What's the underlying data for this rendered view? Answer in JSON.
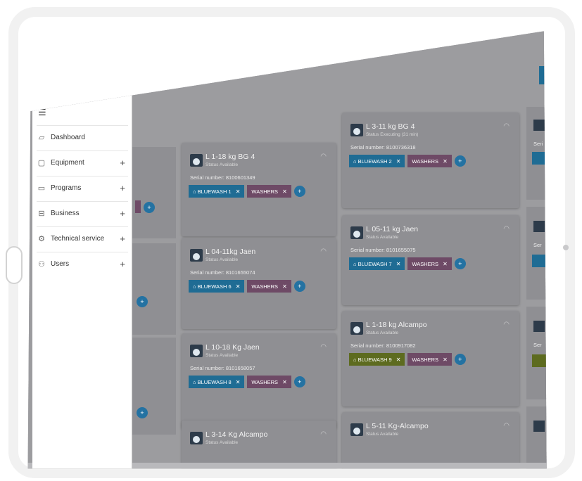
{
  "drawer": {
    "hamburger_icon": "menu-icon",
    "items": [
      {
        "label": "Dashboard",
        "icon": "chart-icon",
        "expandable": false
      },
      {
        "label": "Equipment",
        "icon": "box-icon",
        "expandable": true
      },
      {
        "label": "Programs",
        "icon": "program-icon",
        "expandable": true
      },
      {
        "label": "Business",
        "icon": "briefcase-icon",
        "expandable": true
      },
      {
        "label": "Technical service",
        "icon": "service-icon",
        "expandable": true
      },
      {
        "label": "Users",
        "icon": "users-icon",
        "expandable": true
      }
    ]
  },
  "cards": [
    {
      "name": "L 1-18 kg BG 4",
      "status": "Status Available",
      "serial": "Serial number: 8100601349",
      "chip1": "BLUEWASH 1",
      "chip2": "WASHERS",
      "chip1_color": "#1f6c94"
    },
    {
      "name": "L 3-11 kg BG 4",
      "status": "Status Executing (31 min)",
      "serial": "Serial number: 8100736318",
      "chip1": "BLUEWASH 2",
      "chip2": "WASHERS",
      "chip1_color": "#1f6c94"
    },
    {
      "name": "L 04-11kg Jaen",
      "status": "Status Available",
      "serial": "Serial number: 8101655074",
      "chip1": "BLUEWASH 6",
      "chip2": "WASHERS",
      "chip1_color": "#1f6c94"
    },
    {
      "name": "L 05-11 kg Jaen",
      "status": "Status Available",
      "serial": "Serial number: 8101655075",
      "chip1": "BLUEWASH 7",
      "chip2": "WASHERS",
      "chip1_color": "#1f6c94"
    },
    {
      "name": "L 10-18 Kg Jaen",
      "status": "Status Available",
      "serial": "Serial number: 8101658057",
      "chip1": "BLUEWASH 8",
      "chip2": "WASHERS",
      "chip1_color": "#1f6c94"
    },
    {
      "name": "L 1-18 kg Alcampo",
      "status": "Status Available",
      "serial": "Serial number: 8100917082",
      "chip1": "BLUEWASH 9",
      "chip2": "WASHERS",
      "chip1_color": "#5d6b1f"
    },
    {
      "name": "L 3-14 Kg Alcampo",
      "status": "Status Available",
      "serial": "",
      "chip1": "",
      "chip2": "",
      "chip1_color": "#1f6c94"
    },
    {
      "name": "L 5-11 Kg-Alcampo",
      "status": "Status Available",
      "serial": "",
      "chip1": "",
      "chip2": "",
      "chip1_color": "#1f6c94"
    }
  ],
  "right_cards": [
    {
      "serial_label": "Seri"
    },
    {
      "serial_label": "Ser"
    },
    {
      "serial_label": "Ser"
    }
  ]
}
